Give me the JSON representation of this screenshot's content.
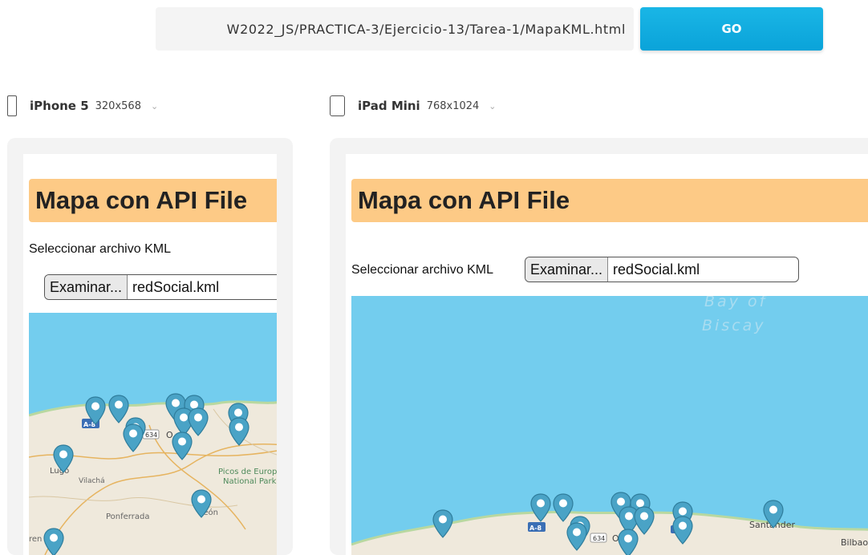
{
  "url_bar": {
    "value": "W2022_JS/PRACTICA-3/Ejercicio-13/Tarea-1/MapaKML.html"
  },
  "go_button": {
    "label": "GO"
  },
  "devices": [
    {
      "name": "iPhone 5",
      "size": "320x568"
    },
    {
      "name": "iPad Mini",
      "size": "768x1024"
    }
  ],
  "page": {
    "title": "Mapa con API File",
    "select_label": "Seleccionar archivo KML",
    "browse_label": "Examinar...",
    "file_name": "redSocial.kml"
  },
  "map_labels": {
    "sea_line1": "Bay of",
    "sea_line2": "Biscay",
    "road_a8": "A-8",
    "road_634": "634",
    "road_o": "O",
    "lugo": "Lugo",
    "vilacha": "Vilachá",
    "ponferrada": "Ponferrada",
    "picos_1": "Picos de Europ",
    "picos_2": "National Park",
    "leon": "León",
    "santander": "Santander",
    "bilbao": "Bilbao",
    "ren": "ren"
  },
  "colors": {
    "accent": "#0aa3d9",
    "title_bg": "#fdca86",
    "sea": "#73cdee",
    "marker": "#4aa3c6"
  }
}
